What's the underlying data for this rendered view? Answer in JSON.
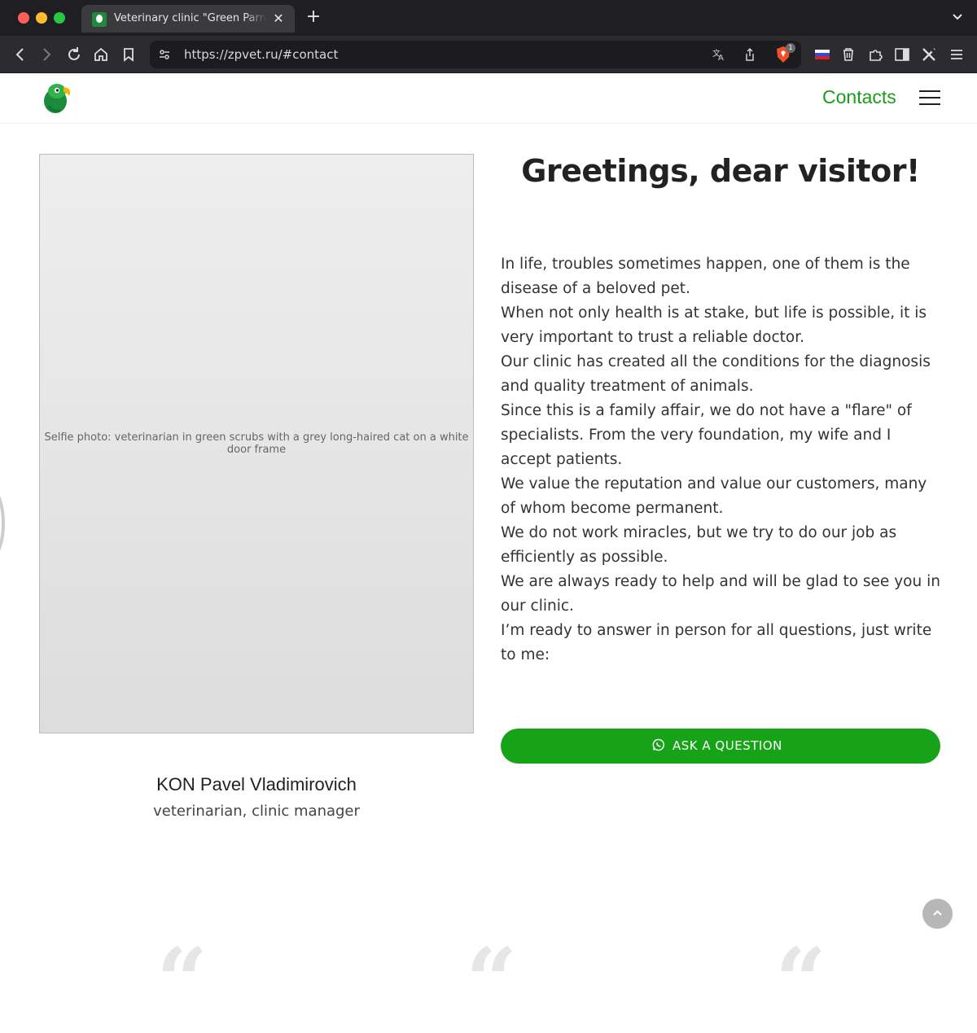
{
  "browser": {
    "tab_title": "Veterinary clinic \"Green Parrot\"",
    "tab_close": "✕",
    "new_tab": "+",
    "url": "https://zpvet.ru/#contact",
    "brave_badge": "1"
  },
  "header": {
    "nav_link": "Contacts"
  },
  "main": {
    "photo_label": "Selfie photo: veterinarian in green scrubs with a grey long-haired cat on a white door frame",
    "doctor_name": "KON Pavel Vladimirovich",
    "doctor_role": "veterinarian, clinic manager",
    "greeting": "Greetings, dear visitor!",
    "paragraphs": [
      "In life, troubles sometimes happen, one of them is the disease of a beloved pet.",
      "When not only health is at stake, but life is possible, it is very important to trust a reliable doctor.",
      "Our clinic has created all the conditions for the diagnosis and quality treatment of animals.",
      "Since this is a family affair, we do not have a \"flare\" of specialists. From the very foundation, my wife and I accept patients.",
      "We value the reputation and value our customers, many of whom become permanent.",
      "We do not work miracles, but we try to do our job as efficiently as possible.",
      "We are always ready to help and will be glad to see you in our clinic.",
      "I’m ready to answer in person for all questions, just write to me:"
    ],
    "ask_button": "ASK A QUESTION"
  },
  "decor": {
    "quote_glyph": "“"
  },
  "colors": {
    "accent": "#17a317",
    "nav_link": "#1a9e1a",
    "chrome_dark": "#1f1f23"
  }
}
